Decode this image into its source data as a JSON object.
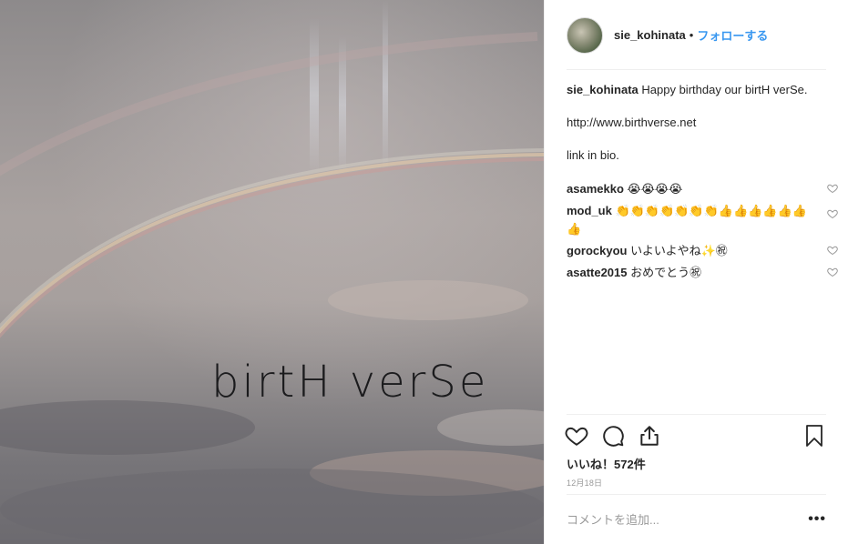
{
  "photo": {
    "overlay_text": "birtH verSe"
  },
  "header": {
    "username": "sie_kohinata",
    "separator": "•",
    "follow_label": "フォローする"
  },
  "caption": {
    "username": "sie_kohinata",
    "text": "Happy birthday our birtH verSe.",
    "line2": "http://www.birthverse.net",
    "line3": "link in bio."
  },
  "comments": [
    {
      "username": "asamekko",
      "text": "😭😭😭😭"
    },
    {
      "username": "mod_uk",
      "text": "👏👏👏👏👏👏👏👍👍👍👍👍👍👍"
    },
    {
      "username": "gorockyou",
      "text": "いよいよやね✨㊗"
    },
    {
      "username": "asatte2015",
      "text": "おめでとう㊗"
    }
  ],
  "actions": {
    "icons": [
      "heart-icon",
      "comment-icon",
      "share-icon",
      "bookmark-icon"
    ],
    "likes": "いいね！572件",
    "date": "12月18日"
  },
  "add_comment": {
    "placeholder": "コメントを追加...",
    "more": "•••"
  },
  "colors": {
    "link": "#3897f0",
    "text": "#262626",
    "muted": "#999999",
    "divider": "#efefef"
  }
}
